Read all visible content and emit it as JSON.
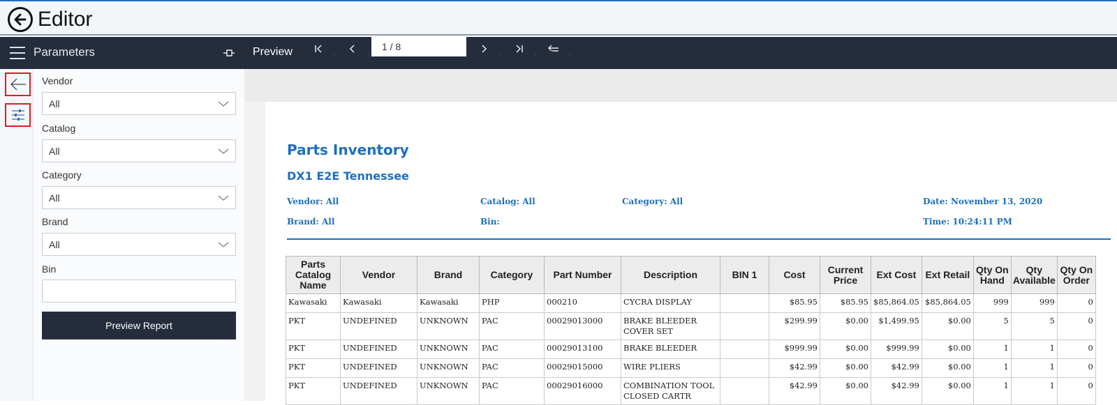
{
  "app": {
    "title": "Editor"
  },
  "toolbar": {
    "params_title": "Parameters",
    "preview_title": "Preview",
    "page_indicator": "1 / 8",
    "nav": {
      "first": "|<",
      "prev": "<",
      "next": ">",
      "last": ">|",
      "toggle": "<="
    }
  },
  "parameters": {
    "vendor": {
      "label": "Vendor",
      "value": "All"
    },
    "catalog": {
      "label": "Catalog",
      "value": "All"
    },
    "category": {
      "label": "Category",
      "value": "All"
    },
    "brand": {
      "label": "Brand",
      "value": "All"
    },
    "bin": {
      "label": "Bin",
      "value": ""
    },
    "preview_button": "Preview Report"
  },
  "report": {
    "title": "Parts Inventory",
    "subtitle": "DX1 E2E Tennessee",
    "meta": {
      "vendor": "Vendor: All",
      "catalog": "Catalog: All",
      "category": "Category: All",
      "date": "Date: November 13, 2020",
      "brand": "Brand: All",
      "bin": "Bin:",
      "time": "Time: 10:24:11 PM"
    },
    "columns": [
      "Parts Catalog Name",
      "Vendor",
      "Brand",
      "Category",
      "Part Number",
      "Description",
      "BIN 1",
      "Cost",
      "Current Price",
      "Ext Cost",
      "Ext Retail",
      "Qty On Hand",
      "Qty Available",
      "Qty On Order"
    ],
    "rows": [
      [
        "Kawasaki",
        "Kawasaki",
        "Kawasaki",
        "PHP",
        "000210",
        "CYCRA DISPLAY",
        "",
        "$85.95",
        "$85.95",
        "$85,864.05",
        "$85,864.05",
        "999",
        "999",
        "0"
      ],
      [
        "PKT",
        "UNDEFINED",
        "UNKNOWN",
        "PAC",
        "00029013000",
        "BRAKE BLEEDER COVER SET",
        "",
        "$299.99",
        "$0.00",
        "$1,499.95",
        "$0.00",
        "5",
        "5",
        "0"
      ],
      [
        "PKT",
        "UNDEFINED",
        "UNKNOWN",
        "PAC",
        "00029013100",
        "BRAKE BLEEDER",
        "",
        "$999.99",
        "$0.00",
        "$999.99",
        "$0.00",
        "1",
        "1",
        "0"
      ],
      [
        "PKT",
        "UNDEFINED",
        "UNKNOWN",
        "PAC",
        "00029015000",
        "WIRE PLIERS",
        "",
        "$42.99",
        "$0.00",
        "$42.99",
        "$0.00",
        "1",
        "1",
        "0"
      ],
      [
        "PKT",
        "UNDEFINED",
        "UNKNOWN",
        "PAC",
        "00029016000",
        "COMBINATION TOOL CLOSED CARTR",
        "",
        "$42.99",
        "$0.00",
        "$42.99",
        "$0.00",
        "1",
        "1",
        "0"
      ]
    ]
  },
  "colors": {
    "accent": "#1e6fbf",
    "toolbar": "#252d3d",
    "highlight": "#e01b24"
  }
}
